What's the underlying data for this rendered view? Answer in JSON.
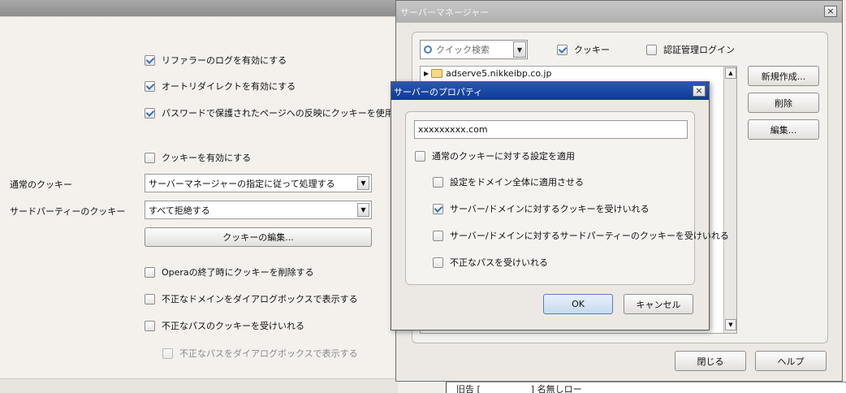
{
  "settings": {
    "referrer_log": "リファラーのログを有効にする",
    "auto_redirect": "オートリダイレクトを有効にする",
    "password_cookies": "パスワードで保護されたページへの反映にクッキーを使用する",
    "enable_cookies": "クッキーを有効にする",
    "normal_cookies_label": "通常のクッキー",
    "normal_cookies_value": "サーバーマネージャーの指定に従って処理する",
    "third_party_label": "サードパーティーのクッキー",
    "third_party_value": "すべて拒絶する",
    "edit_cookies_button": "クッキーの編集...",
    "delete_on_exit": "Operaの終了時にクッキーを削除する",
    "show_invalid_domain": "不正なドメインをダイアログボックスで表示する",
    "accept_invalid_path": "不正なパスのクッキーを受けいれる",
    "show_invalid_path": "不正なパスをダイアログボックスで表示する"
  },
  "server_manager": {
    "title": "サーバーマネージャー",
    "close_glyph": "×",
    "search_placeholder": "クイック検索",
    "cookie_filter": "クッキー",
    "auth_filter": "認証管理ログイン",
    "tree_item": "adserve5.nikkeibp.co.jp",
    "new_button": "新規作成...",
    "delete_button": "削除",
    "edit_button": "編集...",
    "close_button": "閉じる",
    "help_button": "ヘルプ"
  },
  "properties": {
    "title": "サーバーのプロパティ",
    "close_glyph": "×",
    "domain_value": "xxxxxxxxx.com",
    "apply_normal": "通常のクッキーに対する設定を適用",
    "apply_whole_domain": "設定をドメイン全体に適用させる",
    "accept_server_cookies": "サーバー/ドメインに対するクッキーを受けいれる",
    "accept_third_party": "サーバー/ドメインに対するサードパーティーのクッキーを受けいれる",
    "accept_invalid_path": "不正なパスを受けいれる",
    "ok_button": "OK",
    "cancel_button": "キャンセル"
  },
  "underlying_text": "旧告 [ 　　　　　 ] 名無しロー"
}
